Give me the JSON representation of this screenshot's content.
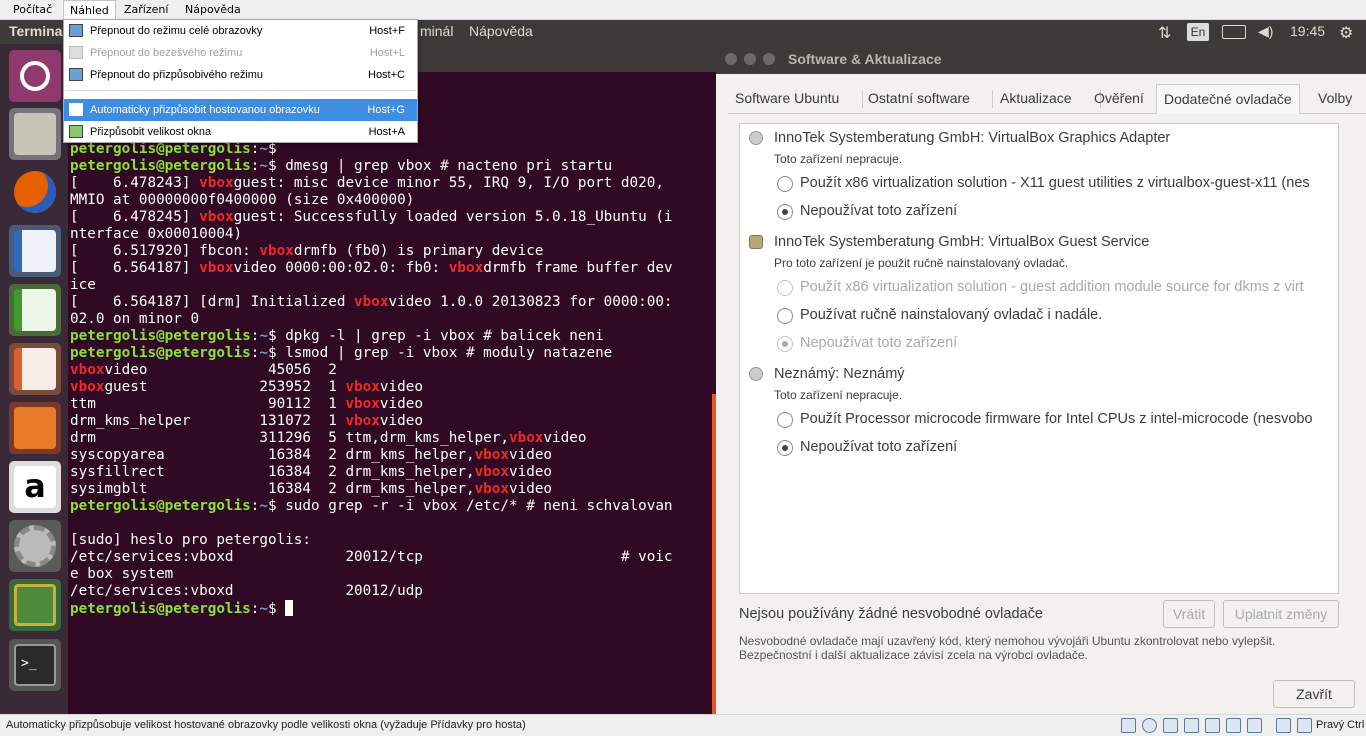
{
  "vbox_menu": {
    "items": [
      "Počítač",
      "Náhled",
      "Zařízení",
      "Nápověda"
    ],
    "dropdown": [
      {
        "label": "Přepnout do režimu celé obrazovky",
        "shortcut": "Host+F",
        "icon": "fullscreen-icon"
      },
      {
        "label": "Přepnout do bezešvého režimu",
        "shortcut": "Host+L",
        "icon": "seamless-icon"
      },
      {
        "label": "Přepnout do přizpůsobivého režimu",
        "shortcut": "Host+C",
        "icon": "scale-icon"
      },
      {
        "label": "Automaticky přizpůsobit hostovanou obrazovku",
        "shortcut": "Host+G",
        "icon": "auto-resize-icon"
      },
      {
        "label": "Přizpůsobit velikost okna",
        "shortcut": "Host+A",
        "icon": "adjust-window-icon"
      }
    ]
  },
  "topbar": {
    "app_title": "Termina",
    "menus": [
      "minál",
      "Nápověda"
    ],
    "keyboard": "En",
    "clock": "19:45"
  },
  "launcher": {
    "items": [
      "ubuntu-icon",
      "files-icon",
      "firefox-icon",
      "writer-icon",
      "calc-icon",
      "impress-icon",
      "software-center-icon",
      "amazon-icon",
      "system-settings-icon",
      "hardware-drivers-icon",
      "terminal-icon"
    ]
  },
  "terminal": {
    "prompt_user": "petergolis@petergolis",
    "prompt_dir": "~",
    "lines": [
      [
        {
          "t": "petergolis@petergolis",
          "c": "p"
        },
        {
          "t": ":",
          "c": "pc"
        },
        {
          "t": "~",
          "c": "pd"
        },
        {
          "t": "$",
          "c": "pc"
        }
      ],
      [
        {
          "t": "petergolis@petergolis",
          "c": "p"
        },
        {
          "t": ":",
          "c": "pc"
        },
        {
          "t": "~",
          "c": "pd"
        },
        {
          "t": "$ dmesg | grep vbox # nacteno pri startu",
          "c": "pc"
        }
      ],
      [
        {
          "t": "[    6.478243] ",
          "c": ""
        },
        {
          "t": "vbox",
          "c": "r"
        },
        {
          "t": "guest: misc device minor 55, IRQ 9, I/O port d020,",
          "c": ""
        }
      ],
      [
        {
          "t": "MMIO at 00000000f0400000 (size 0x400000)",
          "c": ""
        }
      ],
      [
        {
          "t": "[    6.478245] ",
          "c": ""
        },
        {
          "t": "vbox",
          "c": "r"
        },
        {
          "t": "guest: Successfully loaded version 5.0.18_Ubuntu (i",
          "c": ""
        }
      ],
      [
        {
          "t": "nterface 0x00010004)",
          "c": ""
        }
      ],
      [
        {
          "t": "[    6.517920] fbcon: ",
          "c": ""
        },
        {
          "t": "vbox",
          "c": "r"
        },
        {
          "t": "drmfb (fb0) is primary device",
          "c": ""
        }
      ],
      [
        {
          "t": "[    6.564187] ",
          "c": ""
        },
        {
          "t": "vbox",
          "c": "r"
        },
        {
          "t": "video 0000:00:02.0: fb0: ",
          "c": ""
        },
        {
          "t": "vbox",
          "c": "r"
        },
        {
          "t": "drmfb frame buffer dev",
          "c": ""
        }
      ],
      [
        {
          "t": "ice",
          "c": ""
        }
      ],
      [
        {
          "t": "[    6.564187] [drm] Initialized ",
          "c": ""
        },
        {
          "t": "vbox",
          "c": "r"
        },
        {
          "t": "video 1.0.0 20130823 for 0000:00:",
          "c": ""
        }
      ],
      [
        {
          "t": "02.0 on minor 0",
          "c": ""
        }
      ],
      [
        {
          "t": "petergolis@petergolis",
          "c": "p"
        },
        {
          "t": ":",
          "c": "pc"
        },
        {
          "t": "~",
          "c": "pd"
        },
        {
          "t": "$ dpkg -l | grep -i vbox # balicek neni",
          "c": "pc"
        }
      ],
      [
        {
          "t": "petergolis@petergolis",
          "c": "p"
        },
        {
          "t": ":",
          "c": "pc"
        },
        {
          "t": "~",
          "c": "pd"
        },
        {
          "t": "$ lsmod | grep -i vbox # moduly natazene",
          "c": "pc"
        }
      ],
      [
        {
          "t": "vbox",
          "c": "r"
        },
        {
          "t": "video              45056  2",
          "c": ""
        }
      ],
      [
        {
          "t": "vbox",
          "c": "r"
        },
        {
          "t": "guest             253952  1 ",
          "c": ""
        },
        {
          "t": "vbox",
          "c": "r"
        },
        {
          "t": "video",
          "c": ""
        }
      ],
      [
        {
          "t": "ttm                    90112  1 ",
          "c": ""
        },
        {
          "t": "vbox",
          "c": "r"
        },
        {
          "t": "video",
          "c": ""
        }
      ],
      [
        {
          "t": "drm_kms_helper        131072  1 ",
          "c": ""
        },
        {
          "t": "vbox",
          "c": "r"
        },
        {
          "t": "video",
          "c": ""
        }
      ],
      [
        {
          "t": "drm                   311296  5 ttm,drm_kms_helper,",
          "c": ""
        },
        {
          "t": "vbox",
          "c": "r"
        },
        {
          "t": "video",
          "c": ""
        }
      ],
      [
        {
          "t": "syscopyarea            16384  2 drm_kms_helper,",
          "c": ""
        },
        {
          "t": "vbox",
          "c": "r"
        },
        {
          "t": "video",
          "c": ""
        }
      ],
      [
        {
          "t": "sysfillrect            16384  2 drm_kms_helper,",
          "c": ""
        },
        {
          "t": "vbox",
          "c": "r"
        },
        {
          "t": "video",
          "c": ""
        }
      ],
      [
        {
          "t": "sysimgblt              16384  2 drm_kms_helper,",
          "c": ""
        },
        {
          "t": "vbox",
          "c": "r"
        },
        {
          "t": "video",
          "c": ""
        }
      ],
      [
        {
          "t": "petergolis@petergolis",
          "c": "p"
        },
        {
          "t": ":",
          "c": "pc"
        },
        {
          "t": "~",
          "c": "pd"
        },
        {
          "t": "$ sudo grep -r -i vbox /etc/* # neni schvalovan",
          "c": "pc"
        }
      ],
      [
        {
          "t": "",
          "c": ""
        }
      ],
      [
        {
          "t": "[sudo] heslo pro petergolis:",
          "c": ""
        }
      ],
      [
        {
          "t": "/etc/services:vboxd             20012/tcp                       # voic",
          "c": ""
        }
      ],
      [
        {
          "t": "e box system",
          "c": ""
        }
      ],
      [
        {
          "t": "/etc/services:vboxd             20012/udp",
          "c": ""
        }
      ],
      [
        {
          "t": "petergolis@petergolis",
          "c": "p"
        },
        {
          "t": ":",
          "c": "pc"
        },
        {
          "t": "~",
          "c": "pd"
        },
        {
          "t": "$ ",
          "c": "pc"
        }
      ]
    ]
  },
  "software_window": {
    "title": "Software & Aktualizace",
    "tabs": [
      "Software Ubuntu",
      "Ostatní software",
      "Aktualizace",
      "Ověření",
      "Dodatečné ovladače",
      "Volby"
    ],
    "active_tab": "Dodatečné ovladače",
    "devices": [
      {
        "name": "InnoTek Systemberatung GmbH: VirtualBox Graphics Adapter",
        "status": "Toto zařízení nepracuje.",
        "options": [
          {
            "label": "Použít x86 virtualization solution - X11 guest utilities z virtualbox-guest-x11 (nes",
            "selected": false,
            "disabled": false
          },
          {
            "label": "Nepoužívat toto zařízení",
            "selected": true,
            "disabled": false
          }
        ]
      },
      {
        "name": "InnoTek Systemberatung GmbH: VirtualBox Guest Service",
        "status": "Pro toto zařízení je použit ručně nainstalovaný ovladač.",
        "options": [
          {
            "label": "Použít x86 virtualization solution - guest addition module source for dkms z virt",
            "selected": false,
            "disabled": true
          },
          {
            "label": "Používat ručně nainstalovaný ovladač i nadále.",
            "selected": false,
            "disabled": false
          },
          {
            "label": "Nepoužívat toto zařízení",
            "selected": true,
            "disabled": true
          }
        ]
      },
      {
        "name": "Neznámý: Neznámý",
        "status": "Toto zařízení nepracuje.",
        "options": [
          {
            "label": "Použít Processor microcode firmware for Intel CPUs z intel-microcode (nesvobo",
            "selected": false,
            "disabled": false
          },
          {
            "label": "Nepoužívat toto zařízení",
            "selected": true,
            "disabled": false
          }
        ]
      }
    ],
    "summary": "Nejsou používány žádné nesvobodné ovladače",
    "revert_button": "Vrátit",
    "apply_button": "Uplatnit změny",
    "note_line1": "Nesvobodné ovladače mají uzavřený kód, který nemohou vývojáři Ubuntu zkontrolovat nebo vylepšit.",
    "note_line2": "Bezpečnostní i další aktualizace závisí zcela na výrobci ovladače.",
    "close_button": "Zavřít"
  },
  "statusbar": {
    "text": "Automaticky přizpůsobuje velikost hostované obrazovky podle velikosti okna (vyžaduje Přídavky pro hosta)",
    "host_key": "Pravý Ctrl"
  },
  "colors": {
    "terminal_bg": "#300a24",
    "prompt_green": "#8ae234",
    "match_red": "#ef2929",
    "ubuntu_orange": "#e95420",
    "menu_highlight": "#3d8ee0"
  }
}
